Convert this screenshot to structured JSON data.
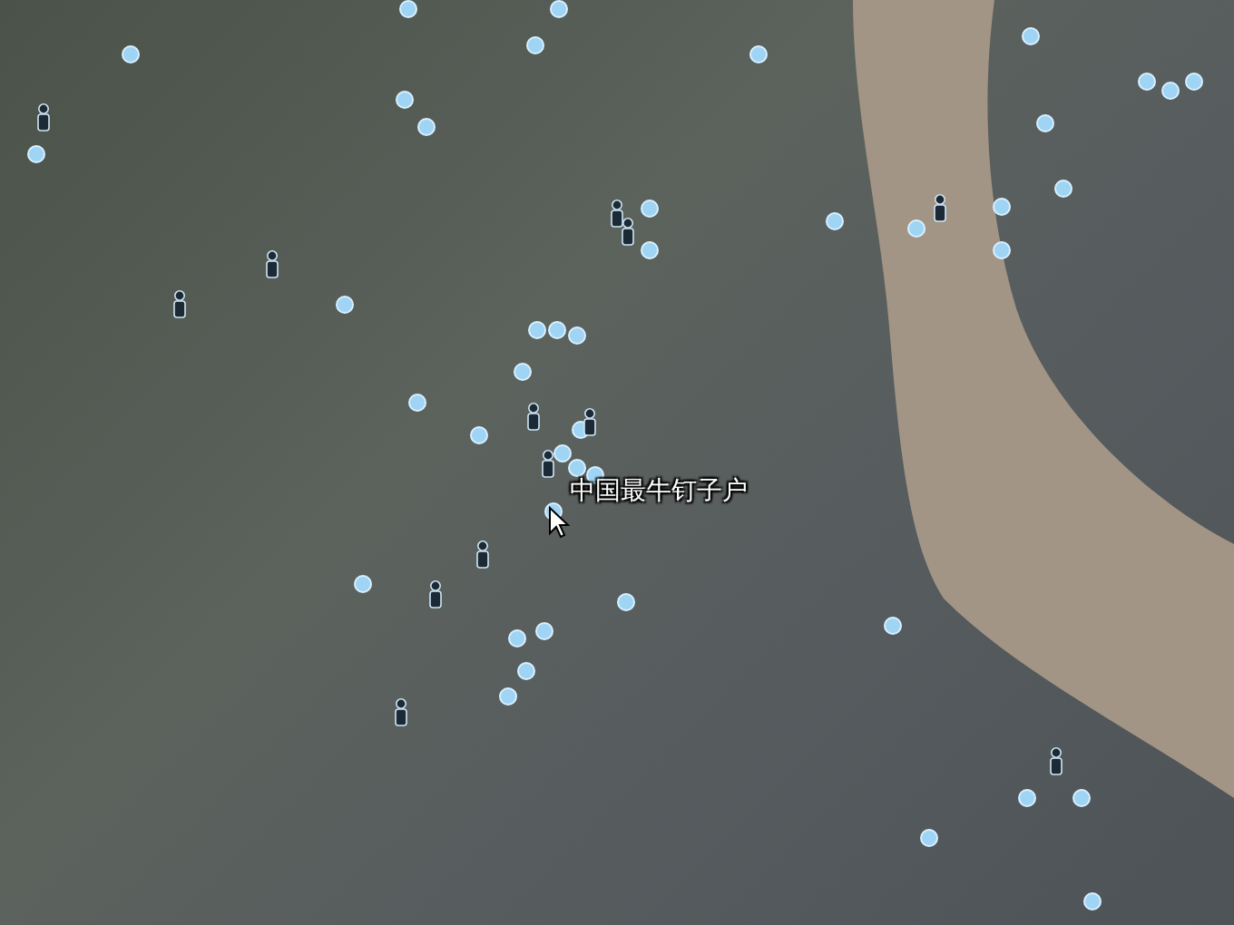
{
  "map": {
    "place_label": "中国最牛钉子户"
  }
}
